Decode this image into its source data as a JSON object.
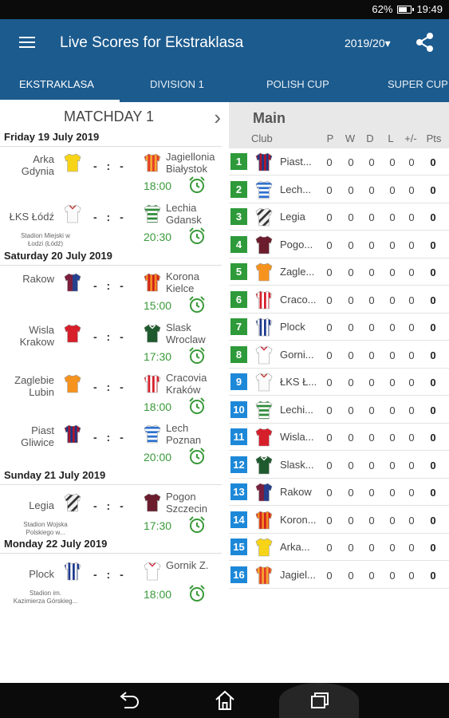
{
  "status_bar": {
    "battery": "62%",
    "time": "19:49"
  },
  "app_bar": {
    "title": "Live Scores for Ekstraklasa",
    "season": "2019/20▾"
  },
  "tabs": [
    {
      "label": "EKSTRAKLASA"
    },
    {
      "label": "DIVISION 1"
    },
    {
      "label": "POLISH CUP"
    },
    {
      "label": "SUPER CUP"
    }
  ],
  "fixtures": {
    "title": "MATCHDAY 1",
    "next_icon": "chevron-right-icon",
    "score_placeholder": "- : -",
    "days": [
      {
        "label": "Friday 19 July 2019"
      },
      {
        "label": "Saturday 20 July 2019"
      },
      {
        "label": "Sunday 21 July 2019"
      },
      {
        "label": "Monday 22 July 2019"
      }
    ],
    "matches": [
      {
        "home": "Arka\nGdynia",
        "away": "Jagiellonia\nBiałystok",
        "time": "18:00",
        "venue": ""
      },
      {
        "home": "ŁKS Łódź",
        "away": "Lechia\nGdansk",
        "time": "20:30",
        "venue": "Stadion Miejski w\nŁodzi (Łódź)"
      },
      {
        "home": "Rakow",
        "away": "Korona\nKielce",
        "time": "15:00",
        "venue": ""
      },
      {
        "home": "Wisla\nKrakow",
        "away": "Slask\nWroclaw",
        "time": "17:30",
        "venue": ""
      },
      {
        "home": "Zaglebie\nLubin",
        "away": "Cracovia\nKraków",
        "time": "18:00",
        "venue": ""
      },
      {
        "home": "Piast\nGliwice",
        "away": "Lech\nPoznan",
        "time": "20:00",
        "venue": ""
      },
      {
        "home": "Legia",
        "away": "Pogon\nSzczecin",
        "time": "17:30",
        "venue": "Stadion Wojska\nPolskiego w..."
      },
      {
        "home": "Plock",
        "away": "Gornik Z.",
        "time": "18:00",
        "venue": "Stadion im.\nKazimierza Górskieg..."
      }
    ]
  },
  "standings": {
    "title": "Main",
    "columns": {
      "club": "Club",
      "p": "P",
      "w": "W",
      "d": "D",
      "l": "L",
      "gd": "+/-",
      "pts": "Pts"
    },
    "rows": [
      {
        "pos": "1",
        "club": "Piast...",
        "p": "0",
        "w": "0",
        "d": "0",
        "l": "0",
        "gd": "0",
        "pts": "0"
      },
      {
        "pos": "2",
        "club": "Lech...",
        "p": "0",
        "w": "0",
        "d": "0",
        "l": "0",
        "gd": "0",
        "pts": "0"
      },
      {
        "pos": "3",
        "club": "Legia",
        "p": "0",
        "w": "0",
        "d": "0",
        "l": "0",
        "gd": "0",
        "pts": "0"
      },
      {
        "pos": "4",
        "club": "Pogo...",
        "p": "0",
        "w": "0",
        "d": "0",
        "l": "0",
        "gd": "0",
        "pts": "0"
      },
      {
        "pos": "5",
        "club": "Zagle...",
        "p": "0",
        "w": "0",
        "d": "0",
        "l": "0",
        "gd": "0",
        "pts": "0"
      },
      {
        "pos": "6",
        "club": "Craco...",
        "p": "0",
        "w": "0",
        "d": "0",
        "l": "0",
        "gd": "0",
        "pts": "0"
      },
      {
        "pos": "7",
        "club": "Plock",
        "p": "0",
        "w": "0",
        "d": "0",
        "l": "0",
        "gd": "0",
        "pts": "0"
      },
      {
        "pos": "8",
        "club": "Gorni...",
        "p": "0",
        "w": "0",
        "d": "0",
        "l": "0",
        "gd": "0",
        "pts": "0"
      },
      {
        "pos": "9",
        "club": "ŁKS Ł...",
        "p": "0",
        "w": "0",
        "d": "0",
        "l": "0",
        "gd": "0",
        "pts": "0"
      },
      {
        "pos": "10",
        "club": "Lechi...",
        "p": "0",
        "w": "0",
        "d": "0",
        "l": "0",
        "gd": "0",
        "pts": "0"
      },
      {
        "pos": "11",
        "club": "Wisla...",
        "p": "0",
        "w": "0",
        "d": "0",
        "l": "0",
        "gd": "0",
        "pts": "0"
      },
      {
        "pos": "12",
        "club": "Slask...",
        "p": "0",
        "w": "0",
        "d": "0",
        "l": "0",
        "gd": "0",
        "pts": "0"
      },
      {
        "pos": "13",
        "club": "Rakow",
        "p": "0",
        "w": "0",
        "d": "0",
        "l": "0",
        "gd": "0",
        "pts": "0"
      },
      {
        "pos": "14",
        "club": "Koron...",
        "p": "0",
        "w": "0",
        "d": "0",
        "l": "0",
        "gd": "0",
        "pts": "0"
      },
      {
        "pos": "15",
        "club": "Arka...",
        "p": "0",
        "w": "0",
        "d": "0",
        "l": "0",
        "gd": "0",
        "pts": "0"
      },
      {
        "pos": "16",
        "club": "Jagiel...",
        "p": "0",
        "w": "0",
        "d": "0",
        "l": "0",
        "gd": "0",
        "pts": "0"
      }
    ]
  },
  "colors": {
    "app_bar": "#1c5b8e",
    "time_green": "#3a9a3a",
    "pos_green": "#2e9a3a",
    "pos_blue": "#1e88d8",
    "pos_red": "#d33a2c"
  },
  "nav_bar": {
    "back": "back-icon",
    "home": "home-icon",
    "recents": "recents-icon"
  }
}
